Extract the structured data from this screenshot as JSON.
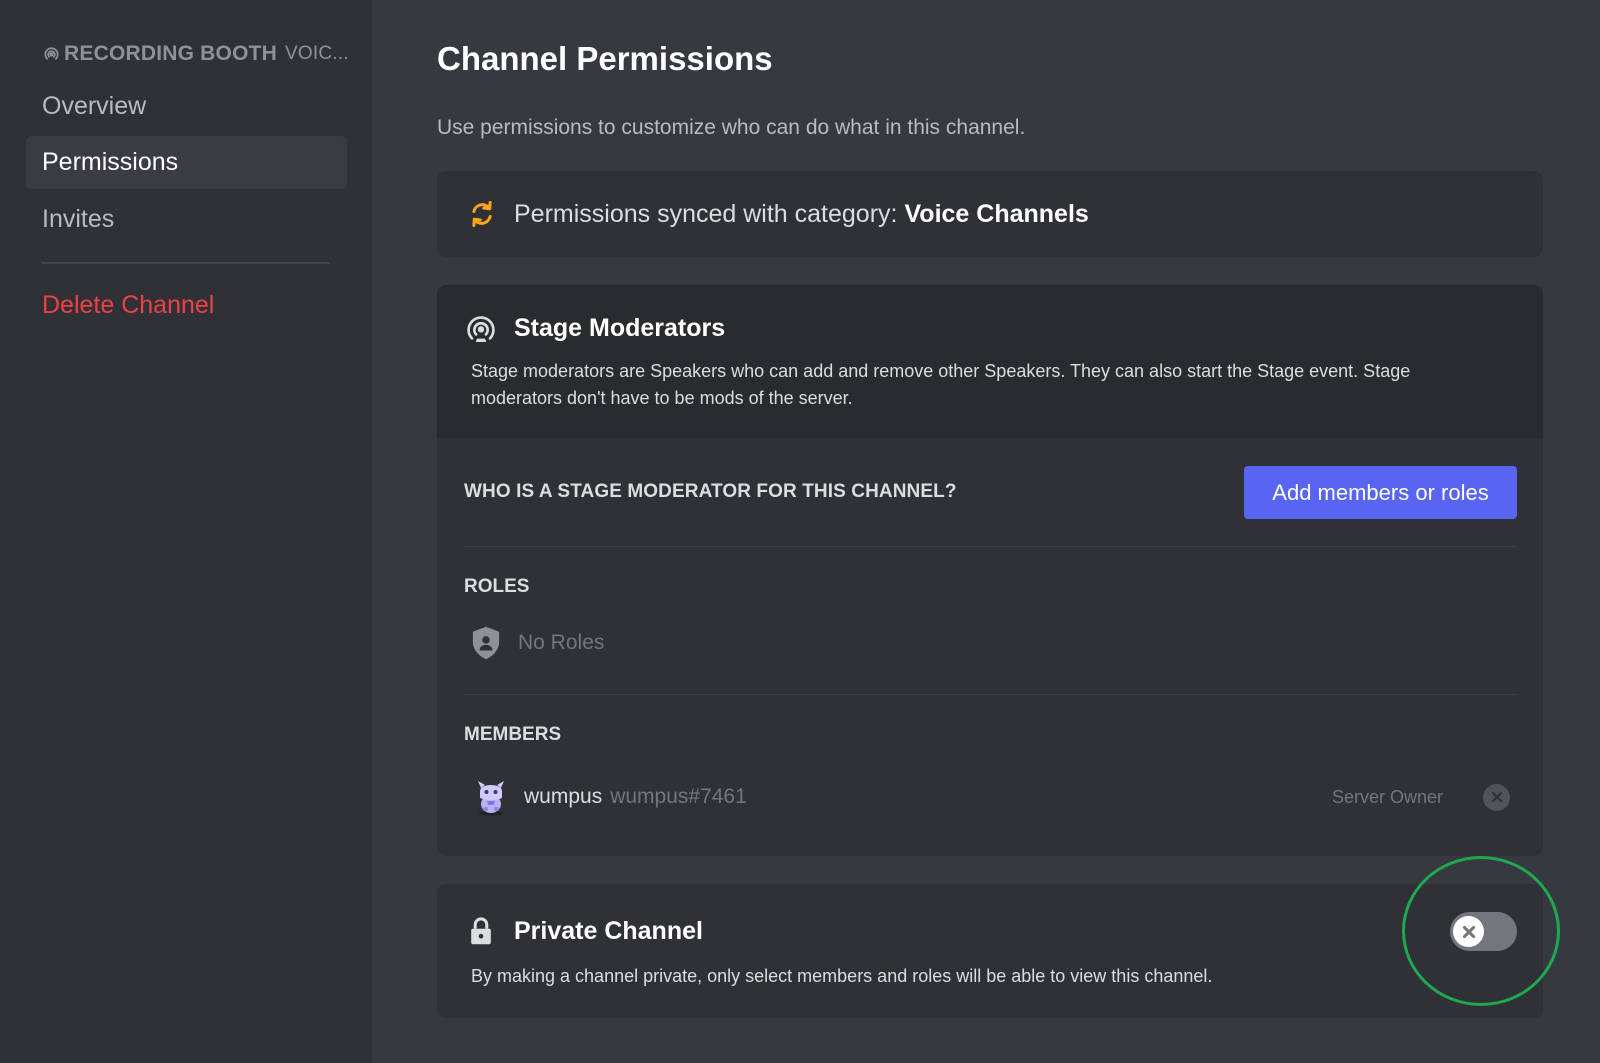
{
  "sidebar": {
    "channel_name": "RECORDING BOOTH",
    "channel_type": "VOIC...",
    "items": [
      {
        "label": "Overview"
      },
      {
        "label": "Permissions"
      },
      {
        "label": "Invites"
      },
      {
        "label": "Delete Channel"
      }
    ],
    "active_item": "Permissions"
  },
  "main": {
    "title": "Channel Permissions",
    "description": "Use permissions to customize who can do what in this channel.",
    "sync": {
      "text": "Permissions synced with category:",
      "category": "Voice Channels",
      "icon": "sync-icon"
    },
    "stage_moderators": {
      "title": "Stage Moderators",
      "description": "Stage moderators are Speakers who can add and remove other Speakers. They can also start the Stage event. Stage moderators don't have to be mods of the server.",
      "question": "WHO IS A STAGE MODERATOR FOR THIS CHANNEL?",
      "add_button": "Add members or roles",
      "roles_label": "ROLES",
      "no_roles": "No Roles",
      "members_label": "MEMBERS",
      "members": [
        {
          "name": "wumpus",
          "tag": "wumpus#7461",
          "role": "Server Owner"
        }
      ]
    },
    "private_channel": {
      "title": "Private Channel",
      "description": "By making a channel private, only select members and roles will be able to view this channel.",
      "enabled": false
    }
  },
  "colors": {
    "background": "#36393f",
    "sidebar": "#2f3136",
    "card": "#2f3136",
    "brand": "#5865f2",
    "danger": "#ed4245",
    "sync_icon": "#faa61a",
    "highlight": "#1fa84f"
  }
}
